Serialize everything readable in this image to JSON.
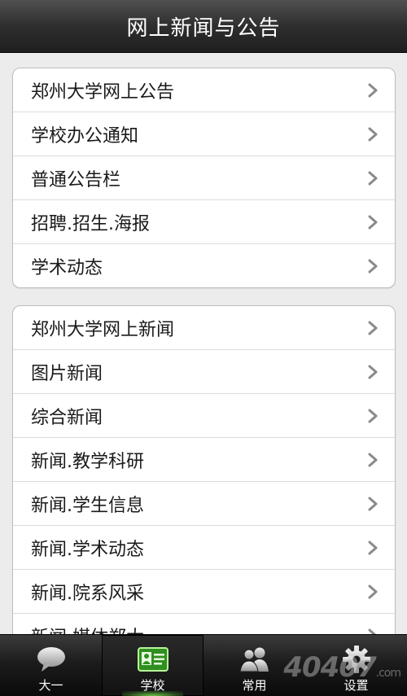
{
  "header": {
    "title": "网上新闻与公告"
  },
  "groups": [
    {
      "items": [
        {
          "label": "郑州大学网上公告"
        },
        {
          "label": "学校办公通知"
        },
        {
          "label": "普通公告栏"
        },
        {
          "label": "招聘.招生.海报"
        },
        {
          "label": "学术动态"
        }
      ]
    },
    {
      "items": [
        {
          "label": "郑州大学网上新闻"
        },
        {
          "label": "图片新闻"
        },
        {
          "label": "综合新闻"
        },
        {
          "label": "新闻.教学科研"
        },
        {
          "label": "新闻.学生信息"
        },
        {
          "label": "新闻.学术动态"
        },
        {
          "label": "新闻.院系风采"
        },
        {
          "label": "新闻.媒体郑大"
        }
      ]
    }
  ],
  "tabbar": {
    "tabs": [
      {
        "label": "大一",
        "icon": "chat-bubble-icon",
        "active": false
      },
      {
        "label": "学校",
        "icon": "id-card-icon",
        "active": true
      },
      {
        "label": "常用",
        "icon": "people-icon",
        "active": false
      },
      {
        "label": "设置",
        "icon": "gear-icon",
        "active": false
      }
    ]
  },
  "watermark": {
    "text": "40407",
    "suffix": ".com"
  },
  "colors": {
    "accent_green": "#5fcf3a",
    "header_bg": "#2e2e2e",
    "page_bg": "#ececec"
  }
}
